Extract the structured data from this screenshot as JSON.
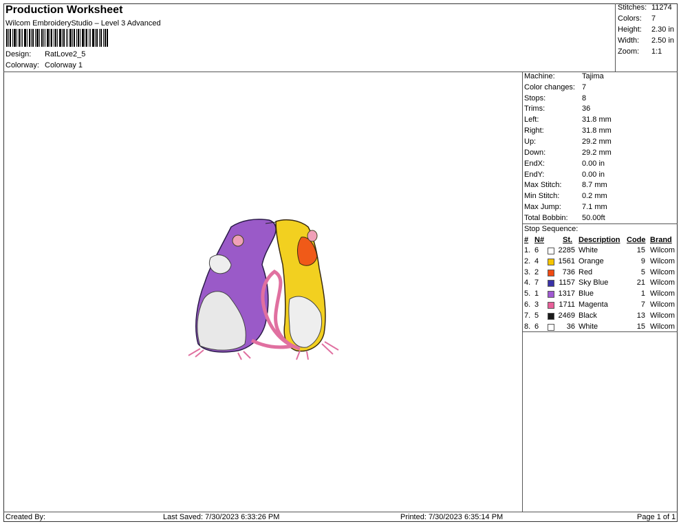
{
  "header": {
    "title": "Production Worksheet",
    "software": "Wilcom EmbroideryStudio – Level 3 Advanced",
    "design_label": "Design:",
    "design_value": "RatLove2_5",
    "colorway_label": "Colorway:",
    "colorway_value": "Colorway 1"
  },
  "top_right": [
    {
      "label": "Stitches:",
      "value": "11274"
    },
    {
      "label": "Colors:",
      "value": "7"
    },
    {
      "label": "Height:",
      "value": "2.30 in"
    },
    {
      "label": "Width:",
      "value": "2.50 in"
    },
    {
      "label": "Zoom:",
      "value": "1:1"
    }
  ],
  "machine_info": [
    {
      "label": "Machine:",
      "value": "Tajima"
    },
    {
      "label": "Color changes:",
      "value": "7"
    },
    {
      "label": "Stops:",
      "value": "8"
    },
    {
      "label": "Trims:",
      "value": "36"
    },
    {
      "label": "Left:",
      "value": "31.8 mm"
    },
    {
      "label": "Right:",
      "value": "31.8 mm"
    },
    {
      "label": "Up:",
      "value": "29.2 mm"
    },
    {
      "label": "Down:",
      "value": "29.2 mm"
    },
    {
      "label": "EndX:",
      "value": "0.00 in"
    },
    {
      "label": "EndY:",
      "value": "0.00 in"
    },
    {
      "label": "Max Stitch:",
      "value": "8.7 mm"
    },
    {
      "label": "Min Stitch:",
      "value": "0.2 mm"
    },
    {
      "label": "Max Jump:",
      "value": "7.1 mm"
    },
    {
      "label": "Total Bobbin:",
      "value": "50.00ft"
    }
  ],
  "stop_sequence": {
    "title": "Stop Sequence:",
    "headers": {
      "num": "#",
      "n": "N#",
      "st": "St.",
      "desc": "Description",
      "code": "Code",
      "brand": "Brand"
    },
    "rows": [
      {
        "num": "1.",
        "n": "6",
        "color": "#ffffff",
        "st": "2285",
        "desc": "White",
        "code": "15",
        "brand": "Wilcom"
      },
      {
        "num": "2.",
        "n": "4",
        "color": "#f5c400",
        "st": "1561",
        "desc": "Orange",
        "code": "9",
        "brand": "Wilcom"
      },
      {
        "num": "3.",
        "n": "2",
        "color": "#f04a12",
        "st": "736",
        "desc": "Red",
        "code": "5",
        "brand": "Wilcom"
      },
      {
        "num": "4.",
        "n": "7",
        "color": "#3a32a8",
        "st": "1157",
        "desc": "Sky Blue",
        "code": "21",
        "brand": "Wilcom"
      },
      {
        "num": "5.",
        "n": "1",
        "color": "#a05ad2",
        "st": "1317",
        "desc": "Blue",
        "code": "1",
        "brand": "Wilcom"
      },
      {
        "num": "6.",
        "n": "3",
        "color": "#e8609a",
        "st": "1711",
        "desc": "Magenta",
        "code": "7",
        "brand": "Wilcom"
      },
      {
        "num": "7.",
        "n": "5",
        "color": "#1a1a1a",
        "st": "2469",
        "desc": "Black",
        "code": "13",
        "brand": "Wilcom"
      },
      {
        "num": "8.",
        "n": "6",
        "color": "#ffffff",
        "st": "36",
        "desc": "White",
        "code": "15",
        "brand": "Wilcom"
      }
    ]
  },
  "footer": {
    "created_by": "Created By:",
    "last_saved": "Last Saved: 7/30/2023 6:33:26 PM",
    "printed": "Printed: 7/30/2023 6:35:14 PM",
    "page": "Page 1 of 1"
  }
}
